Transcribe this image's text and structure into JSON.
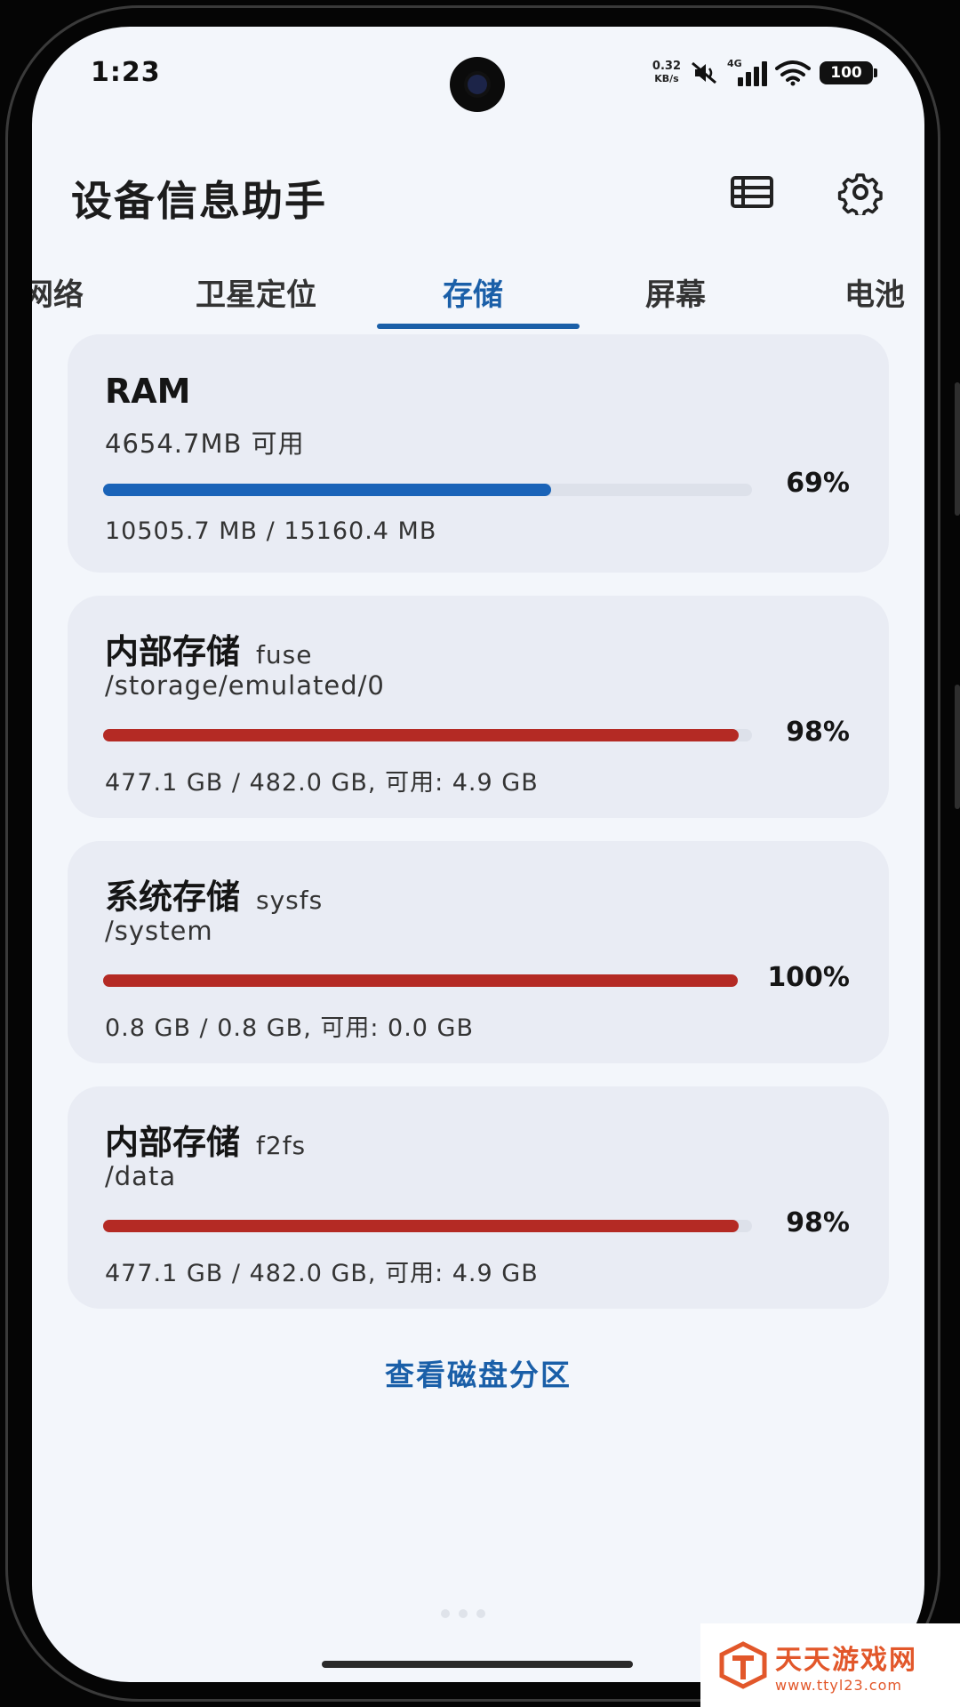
{
  "status_bar": {
    "time": "1:23",
    "net_speed_value": "0.32",
    "net_speed_unit": "KB/s",
    "network_type": "4G",
    "battery": "100"
  },
  "app": {
    "title": "设备信息助手",
    "icons": [
      "list-icon",
      "gear-icon"
    ]
  },
  "tabs": [
    {
      "label": "网络"
    },
    {
      "label": "卫星定位"
    },
    {
      "label": "存储",
      "active": true
    },
    {
      "label": "屏幕"
    },
    {
      "label": "电池"
    }
  ],
  "cards": [
    {
      "title": "RAM",
      "filesystem": "",
      "subtitle": "4654.7MB 可用",
      "percent": 69,
      "percent_label": "69%",
      "footer": "10505.7 MB / 15160.4 MB",
      "color": "#1a63b8"
    },
    {
      "title": "内部存储",
      "filesystem": "fuse",
      "subtitle": "/storage/emulated/0",
      "percent": 98,
      "percent_label": "98%",
      "footer": "477.1 GB / 482.0 GB, 可用: 4.9 GB",
      "color": "#b42a24"
    },
    {
      "title": "系统存储",
      "filesystem": "sysfs",
      "subtitle": "/system",
      "percent": 100,
      "percent_label": "100%",
      "footer": "0.8 GB / 0.8 GB, 可用: 0.0 GB",
      "color": "#b42a24"
    },
    {
      "title": "内部存储",
      "filesystem": "f2fs",
      "subtitle": "/data",
      "percent": 98,
      "percent_label": "98%",
      "footer": "477.1 GB / 482.0 GB, 可用: 4.9 GB",
      "color": "#b42a24"
    }
  ],
  "partition_link": "查看磁盘分区",
  "watermark": {
    "name": "天天游戏网",
    "url": "www.ttyl23.com"
  }
}
